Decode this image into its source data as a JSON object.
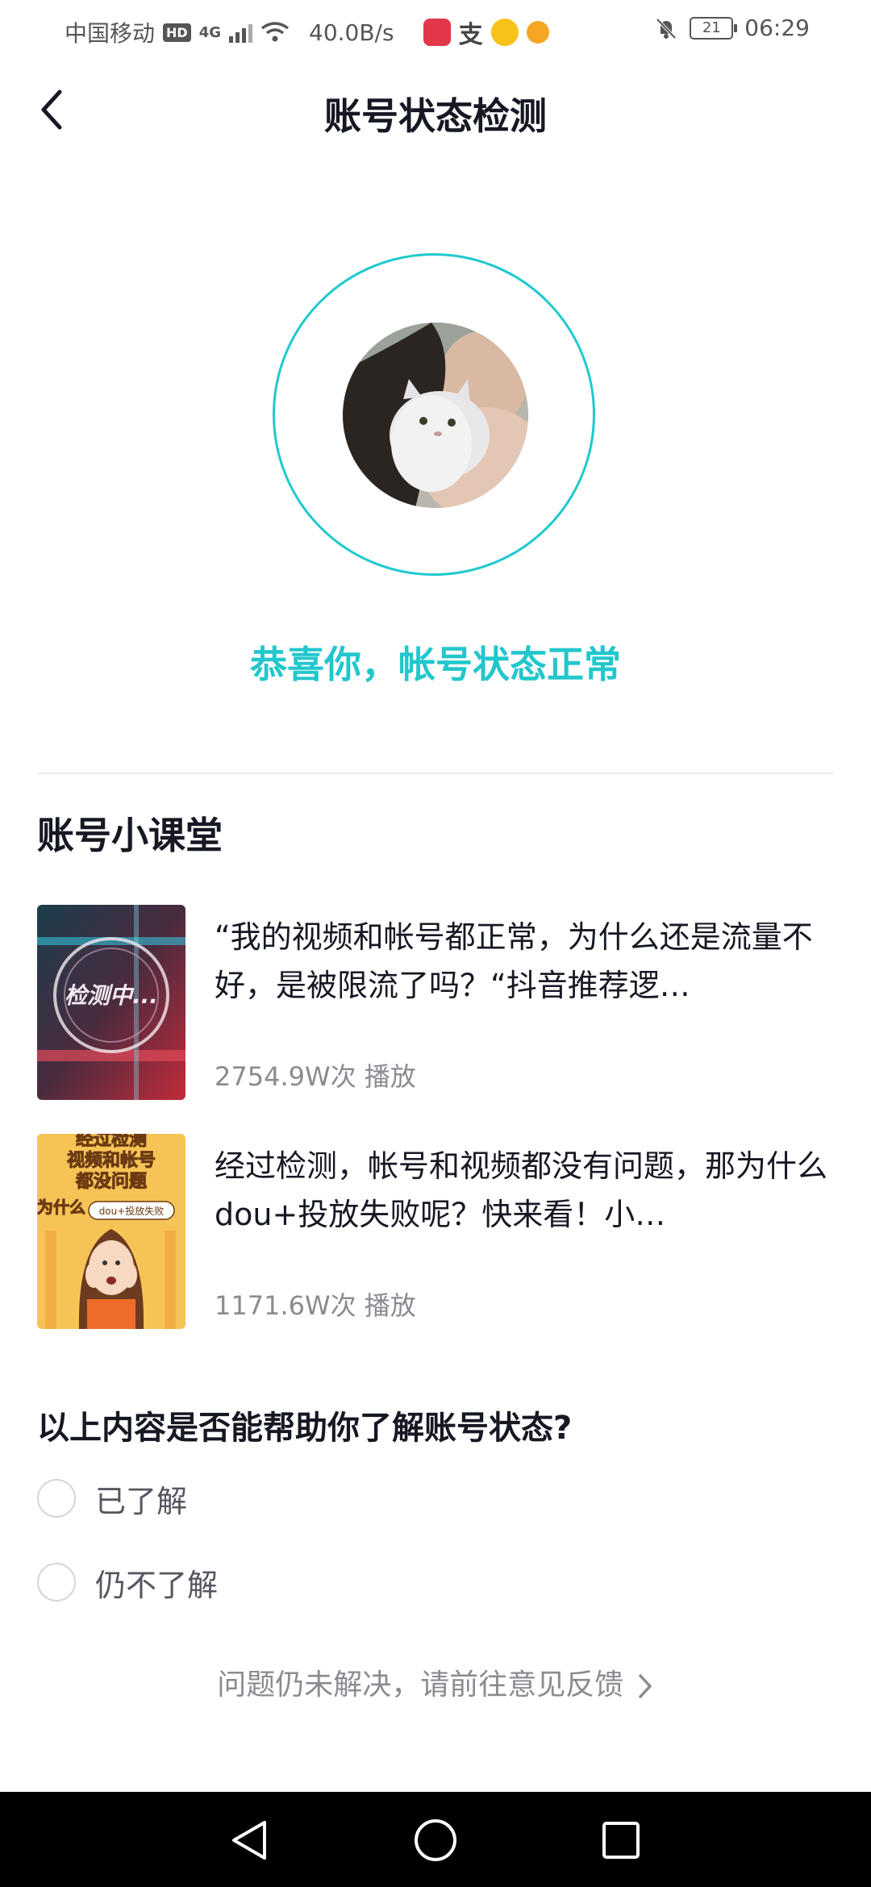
{
  "status_bar": {
    "carrier": "中国移动",
    "hd": "HD",
    "net_type": "4G",
    "speed": "40.0B/s",
    "battery": "21",
    "time": "06:29",
    "icons": [
      "reader-app-icon",
      "alipay-icon",
      "weibo-icon",
      "qq-app-icon",
      "bell-muted-icon"
    ]
  },
  "header": {
    "title": "账号状态检测",
    "back_icon": "chevron-left-icon"
  },
  "status": {
    "message": "恭喜你，帐号状态正常",
    "ring_color": "#20c9cf",
    "message_color": "#22c7cc"
  },
  "lessons": {
    "title": "账号小课堂",
    "items": [
      {
        "title": "“我的视频和帐号都正常，为什么还是流量不好，是被限流了吗？“抖音推荐逻…",
        "plays": "2754.9W次 播放",
        "thumb_text": "检测中..."
      },
      {
        "title": "经过检测，帐号和视频都没有问题，那为什么dou+投放失败呢？快来看！小…",
        "plays": "1171.6W次 播放",
        "thumb_lines": [
          "经过检测",
          "视频和帐号",
          "都没问题",
          "为什么"
        ],
        "thumb_tag": "dou+投放失败"
      }
    ]
  },
  "survey": {
    "question": "以上内容是否能帮助你了解账号状态?",
    "options": [
      "已了解",
      "仍不了解"
    ]
  },
  "feedback": {
    "label": "问题仍未解决，请前往意见反馈"
  },
  "accent_color": "#22c7cc"
}
